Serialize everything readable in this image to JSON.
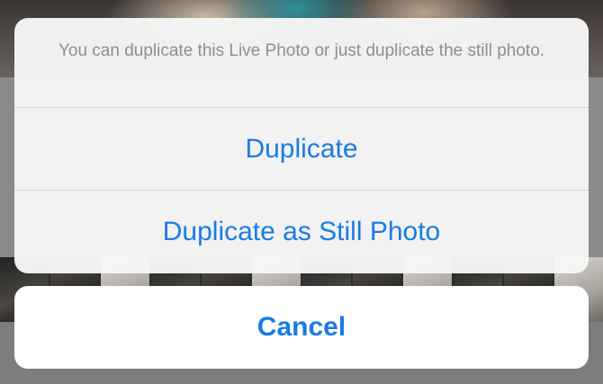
{
  "action_sheet": {
    "message": "You can duplicate this Live Photo or just duplicate the still photo.",
    "actions": [
      {
        "label": "Duplicate"
      },
      {
        "label": "Duplicate as Still Photo"
      }
    ],
    "cancel_label": "Cancel"
  },
  "colors": {
    "action_text": "#1a7be6",
    "message_text": "#8e8e93",
    "sheet_background": "#f6f6f6",
    "cancel_background": "#ffffff"
  }
}
